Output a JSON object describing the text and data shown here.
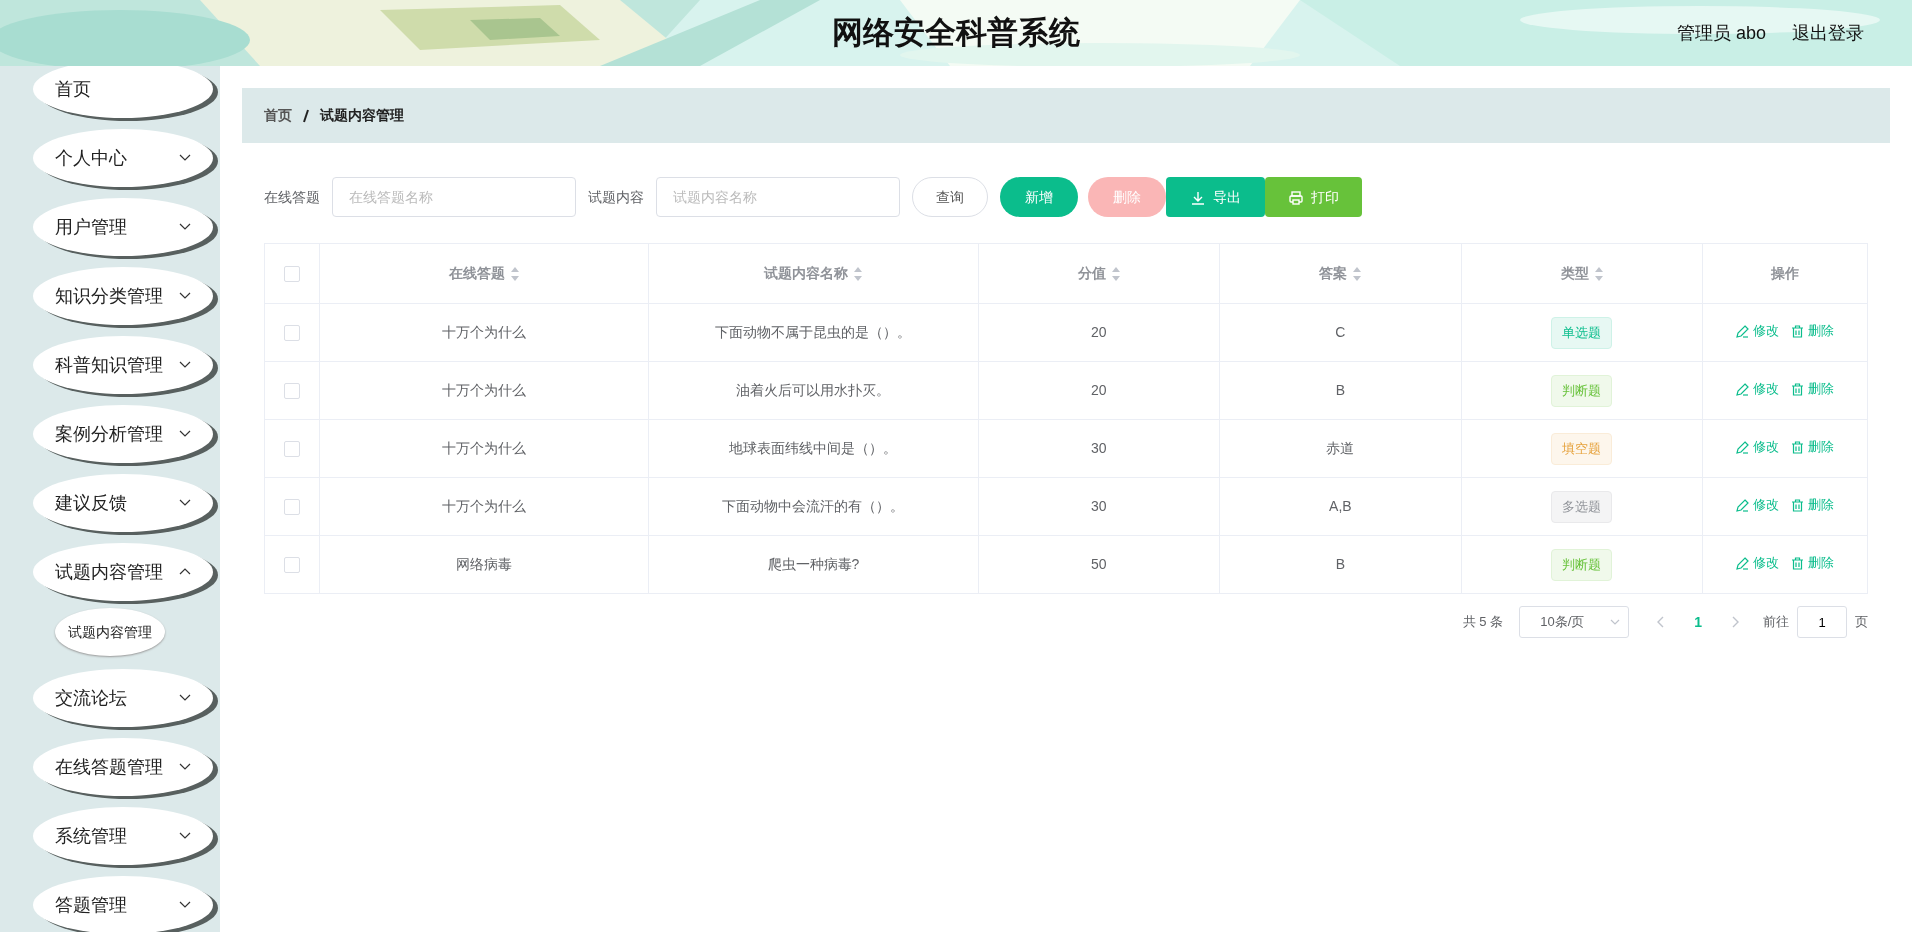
{
  "header": {
    "title": "网络安全科普系统",
    "user": "管理员 abo",
    "logout": "退出登录"
  },
  "sidebar": {
    "items": [
      {
        "label": "首页",
        "has_caret": false,
        "expanded": false
      },
      {
        "label": "个人中心",
        "has_caret": true,
        "expanded": false
      },
      {
        "label": "用户管理",
        "has_caret": true,
        "expanded": false
      },
      {
        "label": "知识分类管理",
        "has_caret": true,
        "expanded": false
      },
      {
        "label": "科普知识管理",
        "has_caret": true,
        "expanded": false
      },
      {
        "label": "案例分析管理",
        "has_caret": true,
        "expanded": false
      },
      {
        "label": "建议反馈",
        "has_caret": true,
        "expanded": false
      },
      {
        "label": "试题内容管理",
        "has_caret": true,
        "expanded": true,
        "children": [
          {
            "label": "试题内容管理"
          }
        ]
      },
      {
        "label": "交流论坛",
        "has_caret": true,
        "expanded": false
      },
      {
        "label": "在线答题管理",
        "has_caret": true,
        "expanded": false
      },
      {
        "label": "系统管理",
        "has_caret": true,
        "expanded": false
      },
      {
        "label": "答题管理",
        "has_caret": true,
        "expanded": false
      }
    ]
  },
  "breadcrumb": [
    "首页",
    "试题内容管理"
  ],
  "search": {
    "fields": [
      {
        "label": "在线答题",
        "placeholder": "在线答题名称"
      },
      {
        "label": "试题内容",
        "placeholder": "试题内容名称"
      }
    ],
    "buttons": [
      {
        "label": "查询",
        "kind": "query"
      },
      {
        "label": "新增",
        "kind": "add"
      },
      {
        "label": "删除",
        "kind": "delete",
        "disabled": true
      },
      {
        "label": "导出",
        "kind": "export"
      },
      {
        "label": "打印",
        "kind": "print"
      }
    ]
  },
  "table": {
    "all_selected": false,
    "columns": [
      {
        "label": "在线答题",
        "sortable": true
      },
      {
        "label": "试题内容名称",
        "sortable": true
      },
      {
        "label": "分值",
        "sortable": true
      },
      {
        "label": "答案",
        "sortable": true
      },
      {
        "label": "类型",
        "sortable": true
      },
      {
        "label": "操作",
        "sortable": false
      }
    ],
    "rows": [
      {
        "selected": false,
        "quiz": "十万个为什么",
        "question": "下面动物不属于昆虫的是（）。",
        "score": "20",
        "answer": "C",
        "type": "单选题",
        "kind": "single",
        "actions": [
          "修改",
          "删除"
        ]
      },
      {
        "selected": false,
        "quiz": "十万个为什么",
        "question": "油着火后可以用水扑灭。",
        "score": "20",
        "answer": "B",
        "type": "判断题",
        "kind": "judge",
        "actions": [
          "修改",
          "删除"
        ]
      },
      {
        "selected": false,
        "quiz": "十万个为什么",
        "question": "地球表面纬线中间是（）。",
        "score": "30",
        "answer": "赤道",
        "type": "填空题",
        "kind": "fill",
        "actions": [
          "修改",
          "删除"
        ]
      },
      {
        "selected": false,
        "quiz": "十万个为什么",
        "question": "下面动物中会流汗的有（）。",
        "score": "30",
        "answer": "A,B",
        "type": "多选题",
        "kind": "multi",
        "actions": [
          "修改",
          "删除"
        ]
      },
      {
        "selected": false,
        "quiz": "网络病毒",
        "question": "爬虫一种病毒?",
        "score": "50",
        "answer": "B",
        "type": "判断题",
        "kind": "judge",
        "actions": [
          "修改",
          "删除"
        ]
      }
    ]
  },
  "pagination": {
    "total": "共 5 条",
    "page_size": "10条/页",
    "pages": [
      {
        "label": "1",
        "selected": true
      }
    ],
    "goto_label": "前往",
    "goto_value": "1",
    "goto_suffix": "页"
  }
}
